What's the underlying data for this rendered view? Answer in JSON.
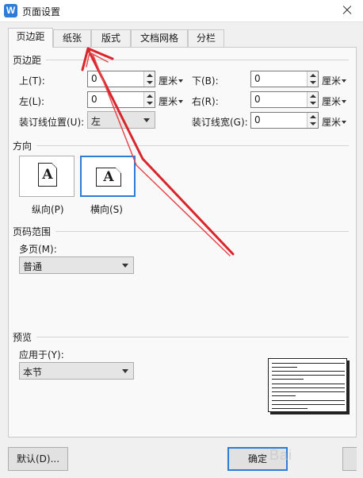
{
  "window": {
    "title": "页面设置",
    "app_icon": "W"
  },
  "tabs": [
    {
      "label": "页边距",
      "active": true
    },
    {
      "label": "纸张",
      "active": false
    },
    {
      "label": "版式",
      "active": false
    },
    {
      "label": "文档网格",
      "active": false
    },
    {
      "label": "分栏",
      "active": false
    }
  ],
  "margins": {
    "group_label": "页边距",
    "top_label": "上(T):",
    "top_value": "0",
    "bottom_label": "下(B):",
    "bottom_value": "0",
    "left_label": "左(L):",
    "left_value": "0",
    "right_label": "右(R):",
    "right_value": "0",
    "unit": "厘米",
    "gutter_pos_label": "装订线位置(U):",
    "gutter_pos_value": "左",
    "gutter_width_label": "装订线宽(G):",
    "gutter_width_value": "0"
  },
  "orientation": {
    "group_label": "方向",
    "portrait_label": "纵向(P)",
    "landscape_label": "横向(S)",
    "icon_letter": "A",
    "selected": "landscape"
  },
  "page_range": {
    "group_label": "页码范围",
    "multi_label": "多页(M):",
    "multi_value": "普通"
  },
  "preview": {
    "group_label": "预览",
    "apply_label": "应用于(Y):",
    "apply_value": "本节"
  },
  "buttons": {
    "default_label": "默认(D)...",
    "ok_label": "确定"
  },
  "watermark": "Bai",
  "colors": {
    "accent": "#2d7cd6",
    "annotation_arrow": "#d9252b"
  }
}
